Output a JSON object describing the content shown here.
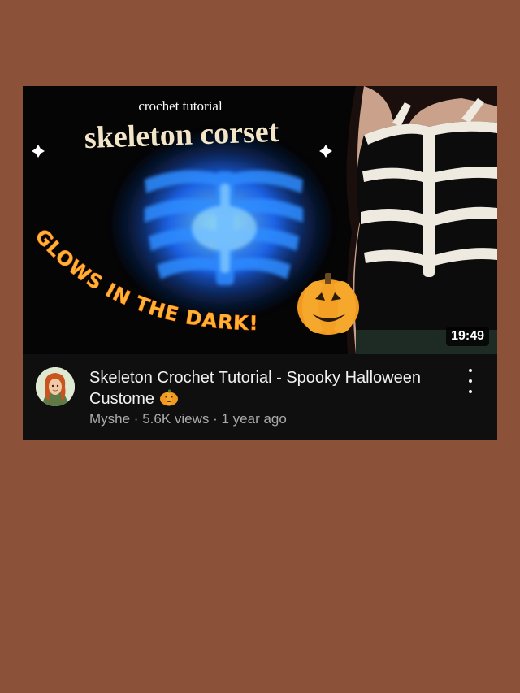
{
  "thumbnail": {
    "overlay_small": "crochet tutorial",
    "overlay_main": "skeleton corset",
    "overlay_curved": "GLOWS IN THE DARK!",
    "duration": "19:49"
  },
  "video": {
    "title": "Skeleton Crochet Tutorial - Spooky Halloween Custome",
    "channel": "Myshe",
    "views": "5.6K views",
    "age": "1 year ago",
    "separator": " · "
  },
  "icons": {
    "title_emoji": "pumpkin-icon",
    "menu": "more-vert-icon"
  },
  "colors": {
    "page_background": "#8b5139",
    "card_background": "#0f0f0f",
    "glow_blue": "#1e6bff",
    "glow_text": "#ffb23a"
  }
}
